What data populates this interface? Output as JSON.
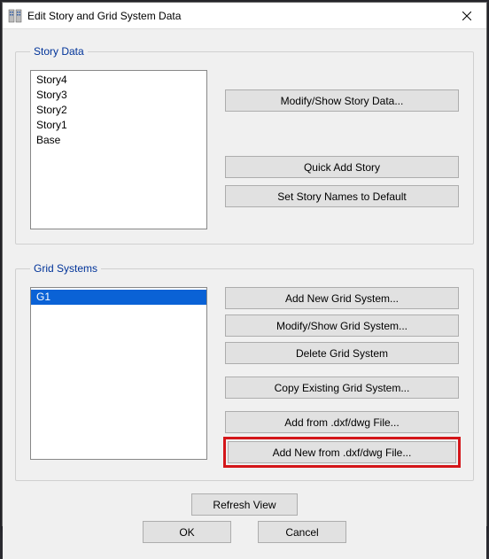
{
  "window": {
    "title": "Edit Story and Grid System Data"
  },
  "storyGroup": {
    "legend": "Story Data",
    "items": [
      "Story4",
      "Story3",
      "Story2",
      "Story1",
      "Base"
    ],
    "buttons": {
      "modifyShow": "Modify/Show Story Data...",
      "quickAdd": "Quick Add Story",
      "setDefault": "Set Story Names to Default"
    }
  },
  "gridGroup": {
    "legend": "Grid Systems",
    "items": [
      "G1"
    ],
    "selectedIndex": 0,
    "buttons": {
      "addNew": "Add New Grid System...",
      "modifyShow": "Modify/Show Grid System...",
      "delete": "Delete Grid System",
      "copyExisting": "Copy Existing Grid System...",
      "addFromDxf": "Add  from .dxf/dwg File...",
      "addNewFromDxf": "Add New from .dxf/dwg File..."
    }
  },
  "actions": {
    "refresh": "Refresh View",
    "ok": "OK",
    "cancel": "Cancel"
  }
}
